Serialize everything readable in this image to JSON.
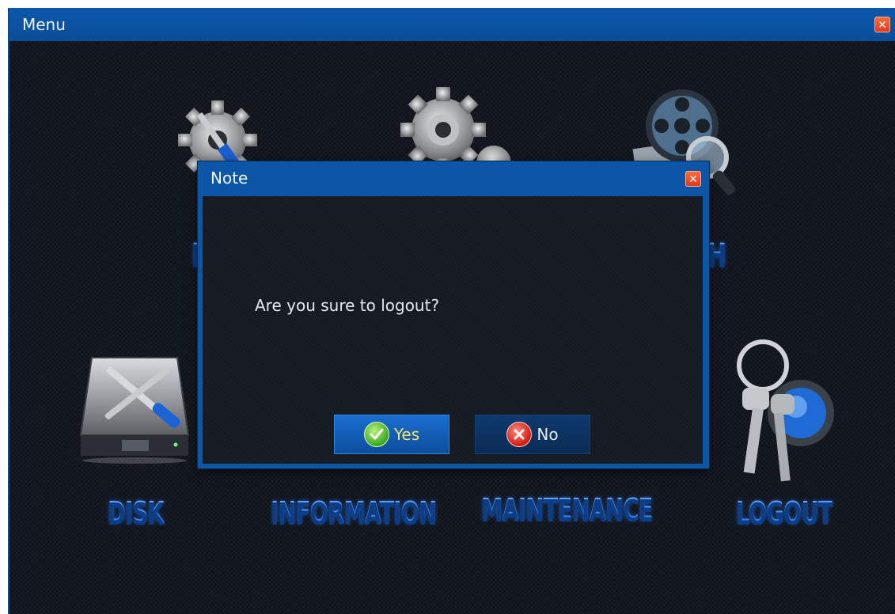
{
  "window": {
    "title": "Menu"
  },
  "menu": {
    "items": [
      {
        "label": "DISK"
      },
      {
        "label": "INFORMATION"
      },
      {
        "label": "MAINTENANCE"
      },
      {
        "label": "LOGOUT"
      }
    ]
  },
  "dialog": {
    "title": "Note",
    "message": "Are you sure to logout?",
    "yes_label": "Yes",
    "no_label": "No"
  },
  "colors": {
    "titlebar": "#0a4d98",
    "background": "#141821",
    "label": "#4a9cff",
    "yes_text": "#f5e26a"
  }
}
